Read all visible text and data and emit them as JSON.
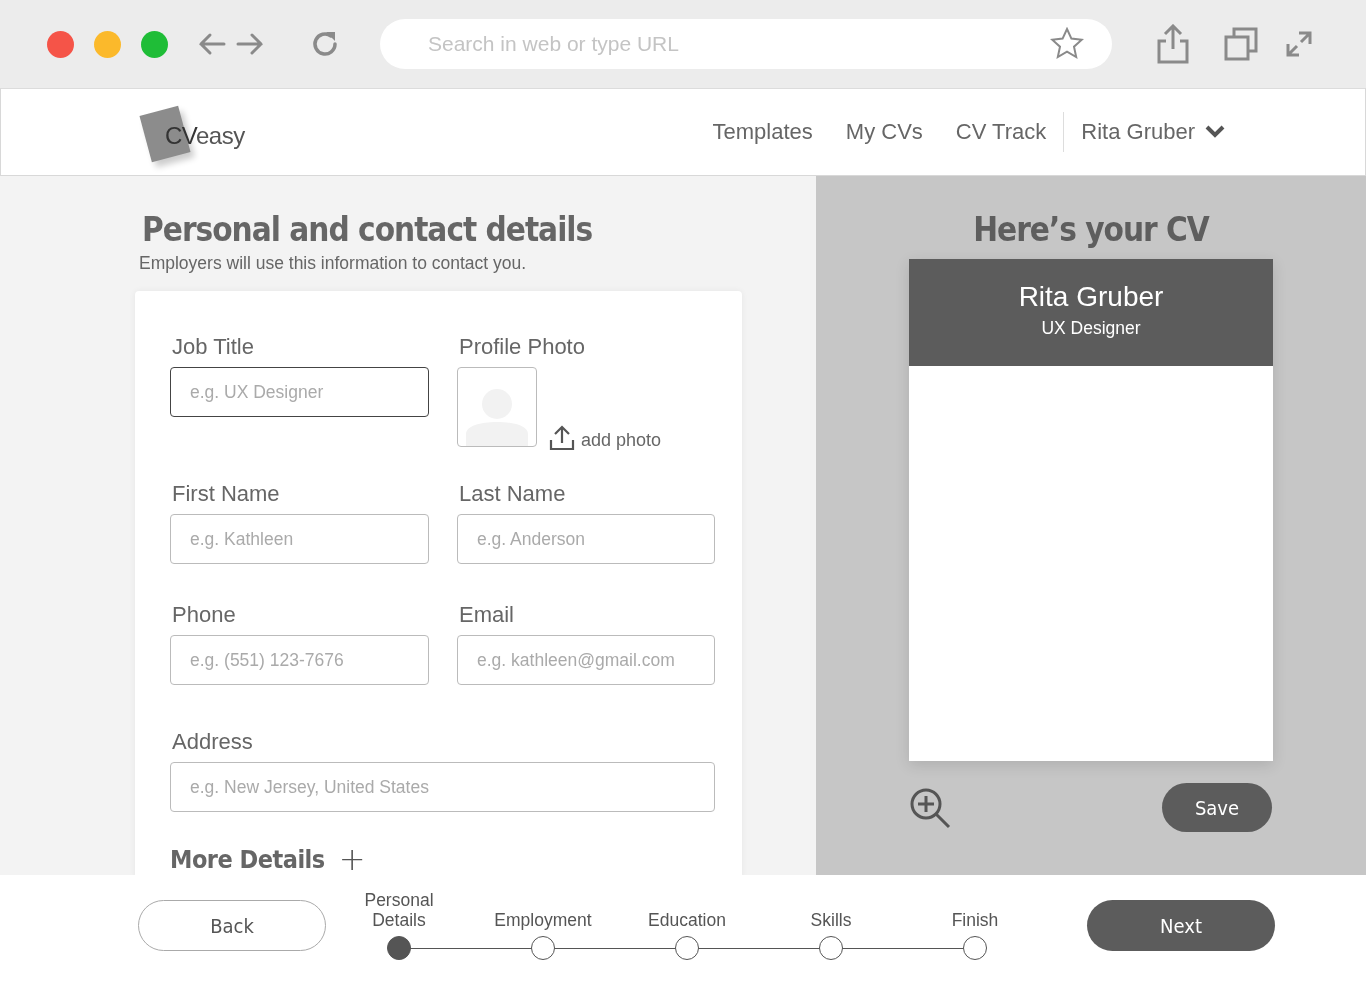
{
  "browser": {
    "address_placeholder": "Search in web or type URL"
  },
  "header": {
    "logo": {
      "mark": "CV",
      "word": "easy"
    },
    "nav": [
      "Templates",
      "My CVs",
      "CV Track"
    ],
    "user": "Rita Gruber"
  },
  "form": {
    "title": "Personal and contact details",
    "subtitle": "Employers will use this information to contact you.",
    "fields": [
      {
        "kind": "text",
        "label": "Job Title",
        "placeholder": "e.g. UX Designer",
        "focused": true
      },
      {
        "kind": "photo",
        "label": "Profile Photo",
        "action": "add photo"
      },
      {
        "kind": "text",
        "label": "First Name",
        "placeholder": "e.g. Kathleen",
        "focused": false
      },
      {
        "kind": "text",
        "label": "Last Name",
        "placeholder": "e.g. Anderson",
        "focused": false
      },
      {
        "kind": "text",
        "label": "Phone",
        "placeholder": "e.g. (551) 123-7676",
        "focused": false
      },
      {
        "kind": "text",
        "label": "Email",
        "placeholder": "e.g. kathleen@gmail.com",
        "focused": false
      },
      {
        "kind": "wide",
        "label": "Address",
        "placeholder": "e.g. New Jersey, United States",
        "focused": false
      }
    ],
    "more": "More Details",
    "more_icon": "+"
  },
  "preview": {
    "title": "Here’s your CV",
    "name": "Rita Gruber",
    "role": "UX Designer",
    "save": "Save"
  },
  "footer": {
    "back": "Back",
    "next": "Next",
    "steps": [
      {
        "label": "Personal Details",
        "selected": true
      },
      {
        "label": "Employment",
        "selected": false
      },
      {
        "label": "Education",
        "selected": false
      },
      {
        "label": "Skills",
        "selected": false
      },
      {
        "label": "Finish",
        "selected": false
      }
    ]
  }
}
